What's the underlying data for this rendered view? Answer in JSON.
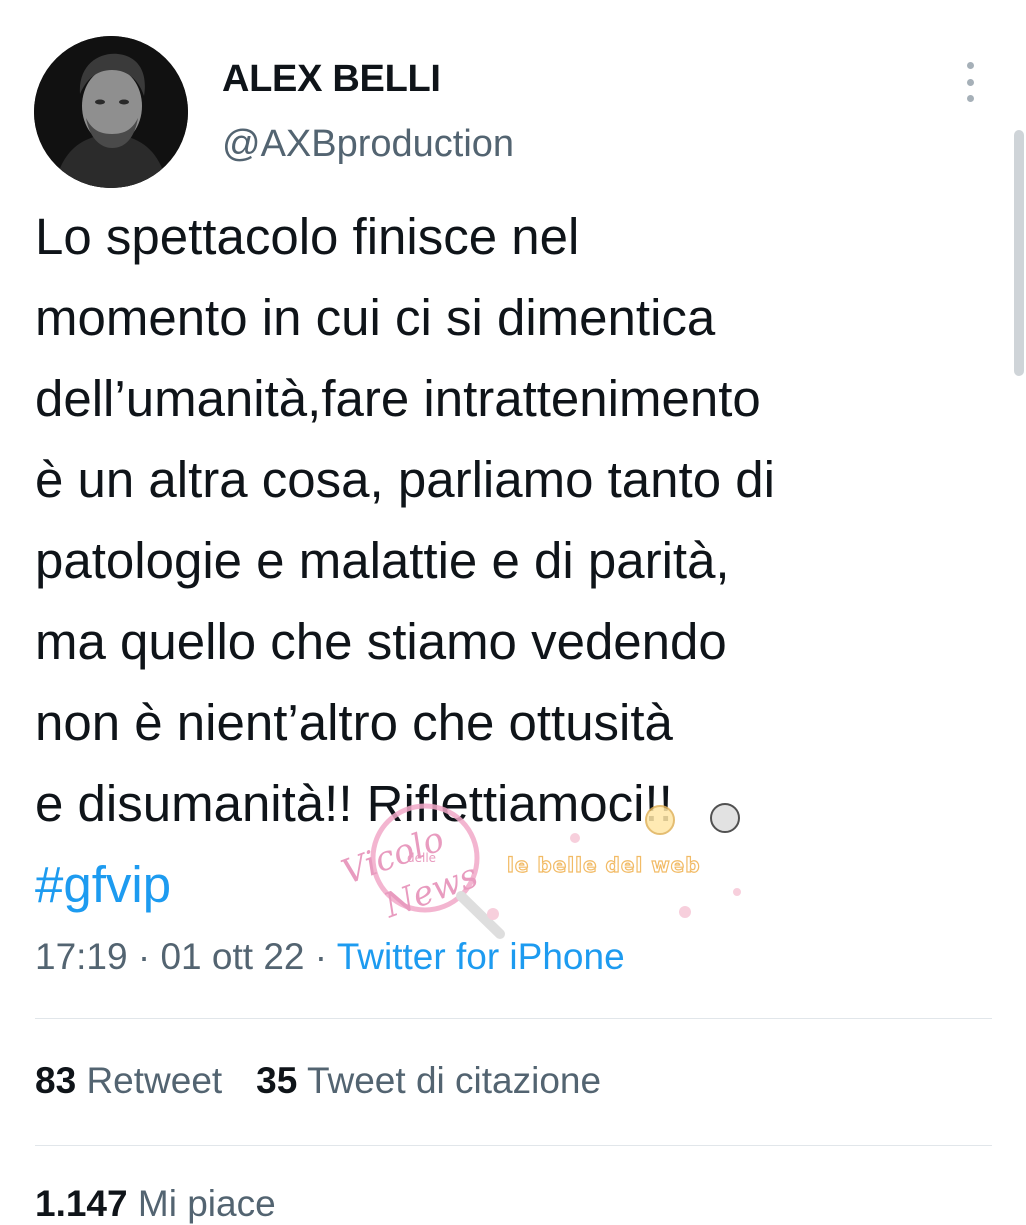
{
  "author": {
    "name": "ALEX BELLI",
    "handle": "@AXBproduction"
  },
  "tweet": {
    "lines": [
      "Lo spettacolo finisce nel",
      "momento in cui ci si dimentica",
      "dell’umanità,fare intrattenimento",
      "è un altra cosa, parliamo tanto di",
      "patologie e malattie e di parità,",
      "ma quello che stiamo vedendo",
      "non è nient’altro che ottusità",
      "e disumanità!! Riflettiamoci!!"
    ],
    "hashtag": "#gfvip"
  },
  "meta": {
    "time": "17:19",
    "separator": "·",
    "date": "01 ott 22",
    "source": "Twitter for iPhone"
  },
  "stats": {
    "retweets_count": "83",
    "retweets_label": "Retweet",
    "quotes_count": "35",
    "quotes_label": "Tweet di citazione",
    "likes_count": "1.147",
    "likes_label": "Mi piace"
  },
  "watermark": {
    "brand_script": "Vicolo",
    "brand_small": "delle",
    "brand_script2": "News",
    "tagline": "le belle del web"
  },
  "colors": {
    "link": "#1d9bf0",
    "secondary_text": "#536471",
    "divider": "#e1e6ea"
  }
}
